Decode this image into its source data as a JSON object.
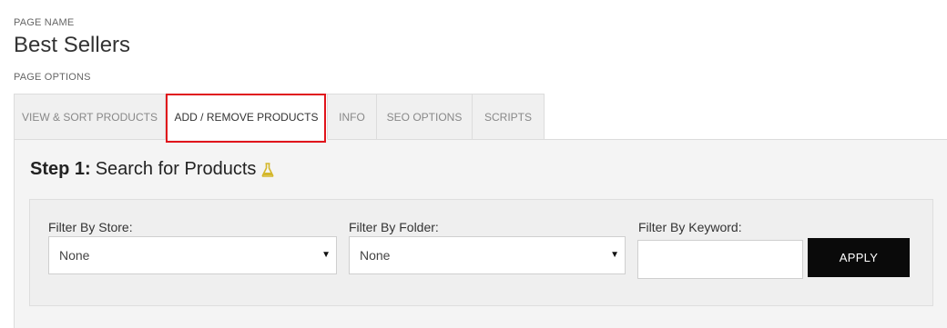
{
  "header": {
    "page_name_label": "PAGE NAME",
    "page_title": "Best Sellers",
    "page_options_label": "PAGE OPTIONS"
  },
  "tabs": [
    {
      "label": "VIEW & SORT PRODUCTS",
      "active": false
    },
    {
      "label": "ADD / REMOVE PRODUCTS",
      "active": true
    },
    {
      "label": "INFO",
      "active": false
    },
    {
      "label": "SEO OPTIONS",
      "active": false
    },
    {
      "label": "SCRIPTS",
      "active": false
    }
  ],
  "step": {
    "prefix": "Step 1:",
    "title": "Search for Products",
    "icon": "flask-icon",
    "icon_color": "#d4b72a"
  },
  "filters": {
    "store": {
      "label": "Filter By Store:",
      "value": "None"
    },
    "folder": {
      "label": "Filter By Folder:",
      "value": "None"
    },
    "keyword": {
      "label": "Filter By Keyword:",
      "value": "",
      "placeholder": ""
    },
    "apply_label": "APPLY"
  },
  "colors": {
    "highlight": "#e0141b",
    "apply_button": "#0a0a0a"
  }
}
